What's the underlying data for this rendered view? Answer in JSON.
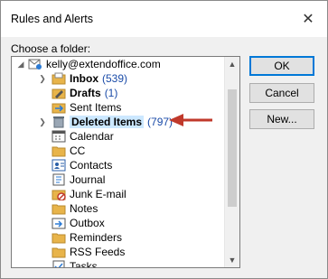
{
  "window": {
    "title": "Rules and Alerts"
  },
  "labels": {
    "choose_folder": "Choose a folder:"
  },
  "tree": {
    "account": "kelly@extendoffice.com",
    "items": [
      {
        "label": "Inbox",
        "count": "(539)",
        "bold": true,
        "expandable": true,
        "icon": "inbox-icon"
      },
      {
        "label": "Drafts",
        "count": "(1)",
        "bold": true,
        "expandable": false,
        "icon": "drafts-icon"
      },
      {
        "label": "Sent Items",
        "count": "",
        "bold": false,
        "expandable": false,
        "icon": "sent-icon"
      },
      {
        "label": "Deleted Items",
        "count": "(797)",
        "bold": true,
        "expandable": true,
        "icon": "deleted-icon",
        "selected": true
      },
      {
        "label": "Calendar",
        "count": "",
        "bold": false,
        "expandable": false,
        "icon": "calendar-icon"
      },
      {
        "label": "CC",
        "count": "",
        "bold": false,
        "expandable": false,
        "icon": "folder-icon"
      },
      {
        "label": "Contacts",
        "count": "",
        "bold": false,
        "expandable": false,
        "icon": "contacts-icon"
      },
      {
        "label": "Journal",
        "count": "",
        "bold": false,
        "expandable": false,
        "icon": "journal-icon"
      },
      {
        "label": "Junk E-mail",
        "count": "",
        "bold": false,
        "expandable": false,
        "icon": "junk-icon"
      },
      {
        "label": "Notes",
        "count": "",
        "bold": false,
        "expandable": false,
        "icon": "notes-icon"
      },
      {
        "label": "Outbox",
        "count": "",
        "bold": false,
        "expandable": false,
        "icon": "outbox-icon"
      },
      {
        "label": "Reminders",
        "count": "",
        "bold": false,
        "expandable": false,
        "icon": "folder-icon"
      },
      {
        "label": "RSS Feeds",
        "count": "",
        "bold": false,
        "expandable": false,
        "icon": "folder-icon"
      },
      {
        "label": "Tasks",
        "count": "",
        "bold": false,
        "expandable": false,
        "icon": "tasks-icon"
      }
    ]
  },
  "buttons": {
    "ok": "OK",
    "cancel": "Cancel",
    "new": "New..."
  },
  "colors": {
    "accent": "#0078d7",
    "count": "#1a4ba8",
    "arrow": "#c0392b",
    "folder": "#e8b44a"
  }
}
